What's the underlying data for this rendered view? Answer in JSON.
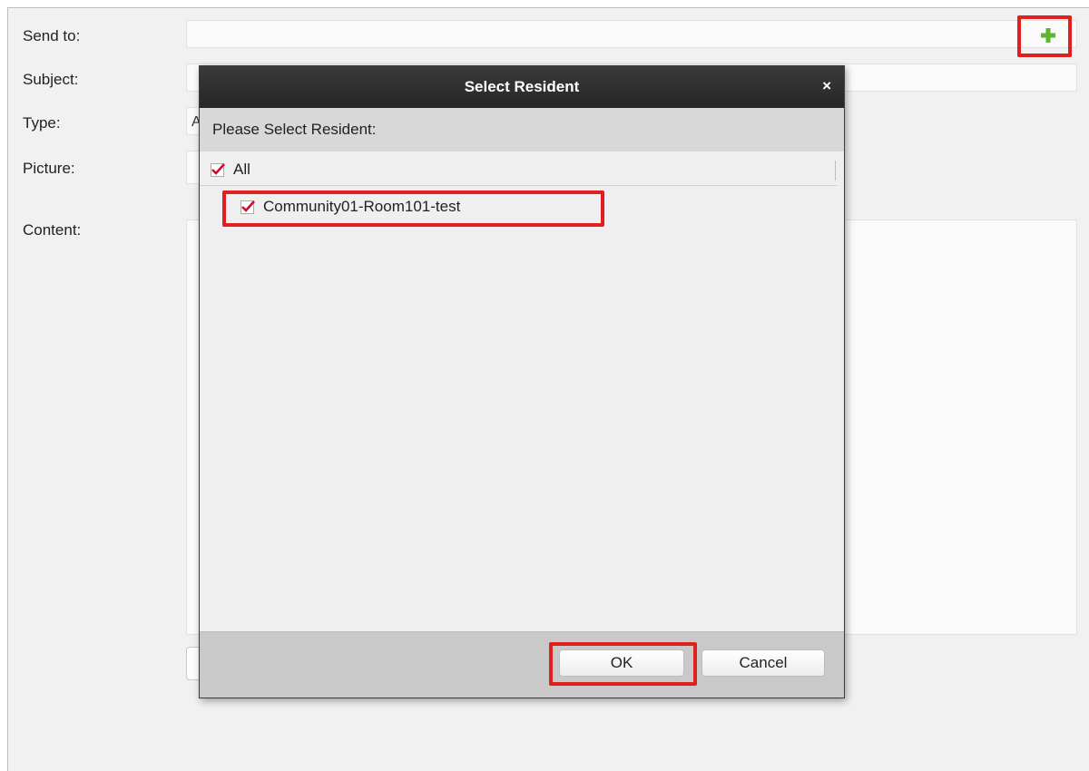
{
  "form": {
    "send_to_label": "Send to:",
    "subject_label": "Subject:",
    "type_label": "Type:",
    "picture_label": "Picture:",
    "content_label": "Content:",
    "type_value_fragment": "A",
    "add_icon": "plus-icon",
    "add_icon_color": "#5cb533"
  },
  "dialog": {
    "title": "Select Resident",
    "close_glyph": "×",
    "prompt": "Please Select Resident:",
    "items": [
      {
        "label": "All",
        "checked": true
      },
      {
        "label": "Community01-Room101-test",
        "checked": true
      }
    ],
    "ok_label": "OK",
    "cancel_label": "Cancel"
  },
  "colors": {
    "highlight": "#e01f1f",
    "check_mark": "#c8102e",
    "title_bar": "#2f2f2f"
  }
}
